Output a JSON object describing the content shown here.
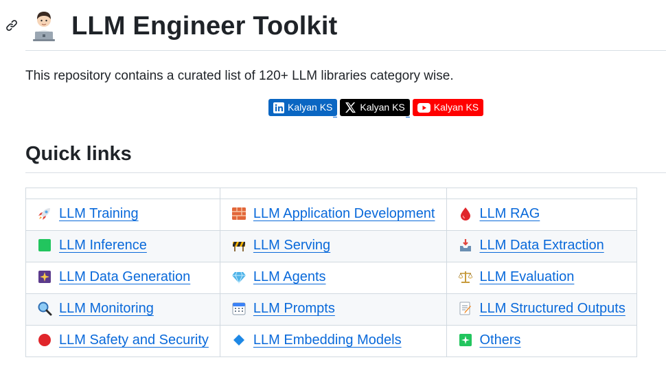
{
  "header": {
    "title": "LLM Engineer Toolkit",
    "intro": "This repository contains a curated list of 120+ LLM libraries category wise."
  },
  "badges": [
    {
      "label": "Kalyan KS",
      "icon": "linkedin-icon",
      "color": "#0a66c2"
    },
    {
      "label": "Kalyan KS",
      "icon": "x-icon",
      "color": "#000000"
    },
    {
      "label": "Kalyan KS",
      "icon": "youtube-icon",
      "color": "#ff0000"
    }
  ],
  "quick_links": {
    "heading": "Quick links",
    "rows": [
      [
        {
          "label": "LLM Training",
          "icon": "rocket-icon"
        },
        {
          "label": "LLM Application Development",
          "icon": "bricks-icon"
        },
        {
          "label": "LLM RAG",
          "icon": "drop-icon"
        }
      ],
      [
        {
          "label": "LLM Inference",
          "icon": "green-square-icon"
        },
        {
          "label": "LLM Serving",
          "icon": "construction-icon"
        },
        {
          "label": "LLM Data Extraction",
          "icon": "inbox-tray-icon"
        }
      ],
      [
        {
          "label": "LLM Data Generation",
          "icon": "sparkles-card-icon"
        },
        {
          "label": "LLM Agents",
          "icon": "diamond-icon"
        },
        {
          "label": "LLM Evaluation",
          "icon": "balance-scale-icon"
        }
      ],
      [
        {
          "label": "LLM Monitoring",
          "icon": "magnifier-icon"
        },
        {
          "label": "LLM Prompts",
          "icon": "calendar-icon"
        },
        {
          "label": "LLM Structured Outputs",
          "icon": "memo-icon"
        }
      ],
      [
        {
          "label": "LLM Safety and Security",
          "icon": "red-circle-icon"
        },
        {
          "label": "LLM Embedding Models",
          "icon": "blue-diamond-icon"
        },
        {
          "label": "Others",
          "icon": "sparkle-box-icon"
        }
      ]
    ]
  }
}
